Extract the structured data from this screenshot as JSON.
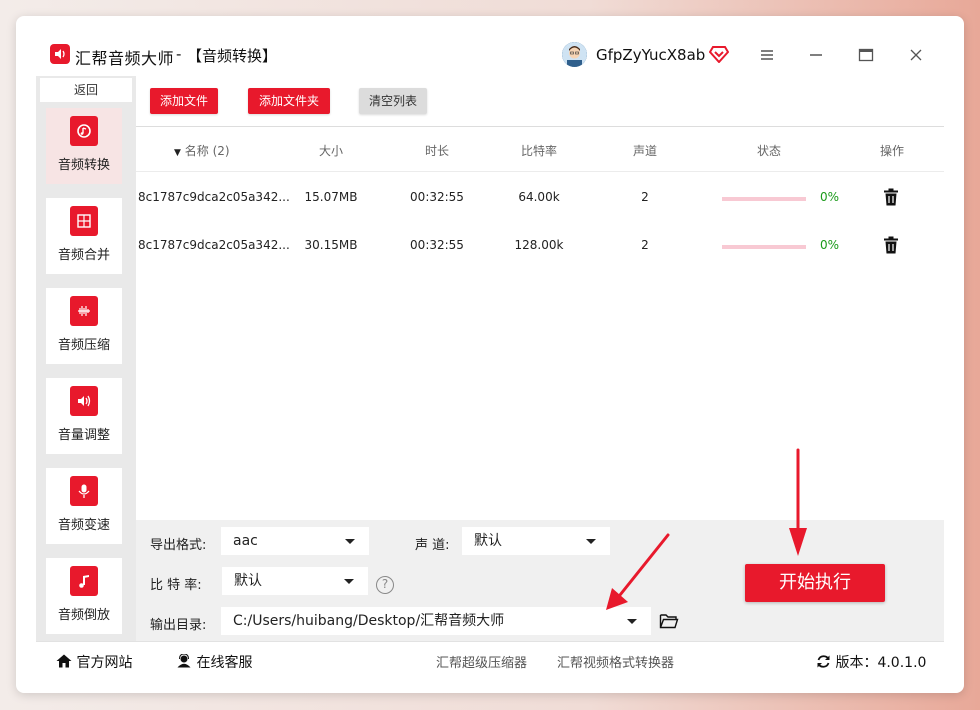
{
  "app": {
    "title": "汇帮音频大师",
    "separator": "-",
    "page_title": "【音频转换】",
    "username": "GfpZyYucX8ab"
  },
  "sidebar": {
    "back_label": "返回",
    "items": [
      {
        "label": "音频转换",
        "icon": "audio-convert-icon",
        "active": true
      },
      {
        "label": "音频合并",
        "icon": "audio-merge-icon",
        "active": false
      },
      {
        "label": "音频压缩",
        "icon": "audio-compress-icon",
        "active": false
      },
      {
        "label": "音量调整",
        "icon": "volume-adjust-icon",
        "active": false
      },
      {
        "label": "音频变速",
        "icon": "audio-speed-icon",
        "active": false
      },
      {
        "label": "音频倒放",
        "icon": "audio-reverse-icon",
        "active": false
      }
    ]
  },
  "toolbar": {
    "add_file": "添加文件",
    "add_folder": "添加文件夹",
    "clear_list": "清空列表"
  },
  "table": {
    "headers": {
      "name": "名称 (2)",
      "size": "大小",
      "duration": "时长",
      "bitrate": "比特率",
      "channels": "声道",
      "status": "状态",
      "actions": "操作"
    },
    "rows": [
      {
        "name": "8c1787c9dca2c05a342...",
        "size": "15.07MB",
        "duration": "00:32:55",
        "bitrate": "64.00k",
        "channels": "2",
        "progress": 0,
        "percent": "0%"
      },
      {
        "name": "8c1787c9dca2c05a342...",
        "size": "30.15MB",
        "duration": "00:32:55",
        "bitrate": "128.00k",
        "channels": "2",
        "progress": 0,
        "percent": "0%"
      }
    ]
  },
  "settings": {
    "format_label": "导出格式:",
    "format_value": "aac",
    "channel_label": "声 道:",
    "channel_value": "默认",
    "bitrate_label": "比 特 率:",
    "bitrate_value": "默认",
    "help": "?",
    "output_label": "输出目录:",
    "output_value": "C:/Users/huibang/Desktop/汇帮音频大师",
    "start_label": "开始执行"
  },
  "footer": {
    "website": "官方网站",
    "support": "在线客服",
    "link1": "汇帮超级压缩器",
    "link2": "汇帮视频格式转换器",
    "version": "版本：4.0.1.0"
  },
  "colors": {
    "brand": "#e8192c",
    "progress_track": "#f8c9d3",
    "percent": "#1a9a1a"
  }
}
